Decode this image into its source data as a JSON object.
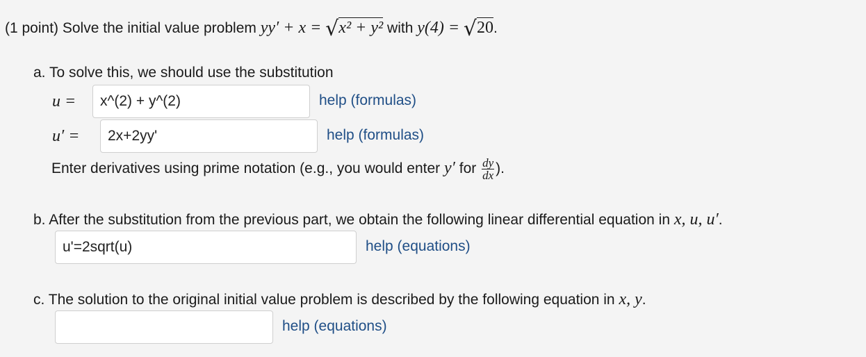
{
  "problem": {
    "prefix": "(1 point) Solve the initial value problem",
    "with_word": "with",
    "equation_lhs": "yy′ + x =",
    "radicand": "x² + y²",
    "condition": "y(4) =",
    "condition_radicand": "20",
    "period": "."
  },
  "part_a": {
    "intro": "a. To solve this, we should use the substitution",
    "u_label": "u =",
    "u_value": "x^(2) + y^(2)",
    "u_help": "help (formulas)",
    "uprime_label": "u′ =",
    "uprime_value": "2x+2yy'",
    "uprime_help": "help (formulas)",
    "note_prefix": "Enter derivatives using prime notation (e.g., you would enter",
    "note_yprime": "y′",
    "note_for": "for",
    "frac_num": "dy",
    "frac_den": "dx",
    "note_suffix": ")."
  },
  "part_b": {
    "intro": "b. After the substitution from the previous part, we obtain the following linear differential equation in",
    "vars": "x, u, u′",
    "period": ".",
    "answer_value": "u'=2sqrt(u)",
    "help": "help (equations)"
  },
  "part_c": {
    "intro": "c. The solution to the original initial value problem is described by the following equation in",
    "vars": "x, y",
    "period": ".",
    "answer_value": "",
    "help": "help (equations)"
  }
}
